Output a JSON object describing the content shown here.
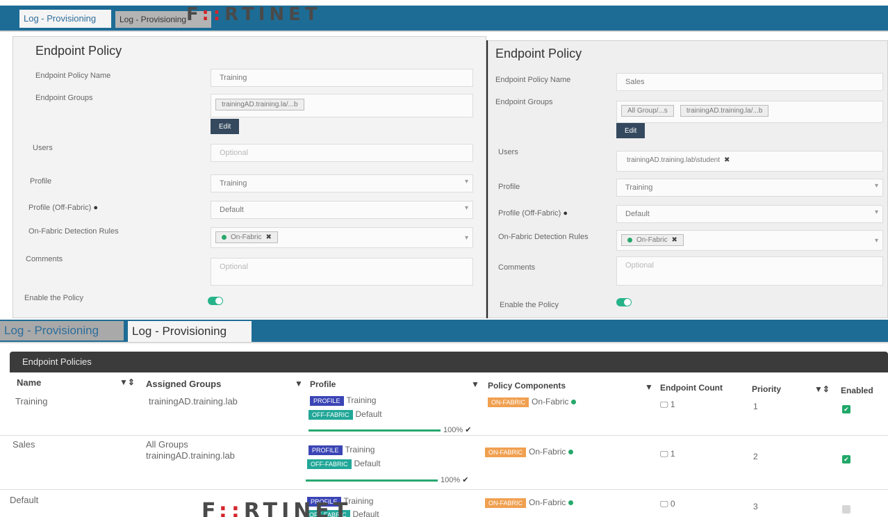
{
  "top_tabs": {
    "tab1": "Log - Provisioning",
    "tab2": "Log - Provisioning"
  },
  "brand": {
    "pre": "F",
    "mid": "::",
    "post": "RTINET"
  },
  "left_policy": {
    "title": "Endpoint Policy",
    "name_label": "Endpoint Policy Name",
    "name_value": "Training",
    "groups_label": "Endpoint Groups",
    "group_chip": "trainingAD.training.la/...b",
    "edit_label": "Edit",
    "users_label": "Users",
    "users_placeholder": "Optional",
    "profile_label": "Profile",
    "profile_value": "Training",
    "off_profile_label": "Profile (Off-Fabric)",
    "off_profile_value": "Default",
    "rules_label": "On-Fabric Detection Rules",
    "rule_chip": "On-Fabric",
    "comments_label": "Comments",
    "comments_placeholder": "Optional",
    "enable_label": "Enable the Policy"
  },
  "right_policy": {
    "title": "Endpoint Policy",
    "name_label": "Endpoint Policy Name",
    "name_value": "Sales",
    "groups_label": "Endpoint Groups",
    "group_chip1": "All Group/...s",
    "group_chip2": "trainingAD.training.la/...b",
    "edit_label": "Edit",
    "users_label": "Users",
    "user_chip": "trainingAD.training.lab\\student",
    "profile_label": "Profile",
    "profile_value": "Training",
    "off_profile_label": "Profile (Off-Fabric)",
    "off_profile_value": "Default",
    "rules_label": "On-Fabric Detection Rules",
    "rule_chip": "On-Fabric",
    "comments_label": "Comments",
    "comments_placeholder": "Optional",
    "enable_label": "Enable the Policy"
  },
  "bottom_tabs": {
    "tab1": "Log - Provisioning",
    "tab2": "Log - Provisioning"
  },
  "policies_table": {
    "title": "Endpoint Policies",
    "headers": {
      "name": "Name",
      "groups": "Assigned Groups",
      "profile": "Profile",
      "components": "Policy Components",
      "count": "Endpoint Count",
      "priority": "Priority",
      "enabled": "Enabled"
    },
    "rows": [
      {
        "name": "Training",
        "groups1": "trainingAD.training.lab",
        "groups2": "",
        "profile_badge": "PROFILE",
        "profile": "Training",
        "off_badge": "OFF-FABRIC",
        "off_profile": "Default",
        "progress": "100%",
        "comp_badge": "ON-FABRIC",
        "comp": "On-Fabric",
        "count": "1",
        "priority": "1",
        "enabled": true
      },
      {
        "name": "Sales",
        "groups1": "All Groups",
        "groups2": "trainingAD.training.lab",
        "profile_badge": "PROFILE",
        "profile": "Training",
        "off_badge": "OFF-FABRIC",
        "off_profile": "Default",
        "progress": "100%",
        "comp_badge": "ON-FABRIC",
        "comp": "On-Fabric",
        "count": "1",
        "priority": "2",
        "enabled": true
      },
      {
        "name": "Default",
        "groups1": "",
        "groups2": "",
        "profile_badge": "PROFILE",
        "profile": "Training",
        "off_badge": "OFF-FABRIC",
        "off_profile": "Default",
        "progress": "",
        "comp_badge": "ON-FABRIC",
        "comp": "On-Fabric",
        "count": "0",
        "priority": "3",
        "enabled": false
      }
    ]
  },
  "icons": {
    "info": "info-circle-icon",
    "filter": "filter-icon",
    "sort": "sort-icon",
    "monitor": "monitor-icon",
    "check": "check-icon",
    "remove": "x-icon"
  }
}
